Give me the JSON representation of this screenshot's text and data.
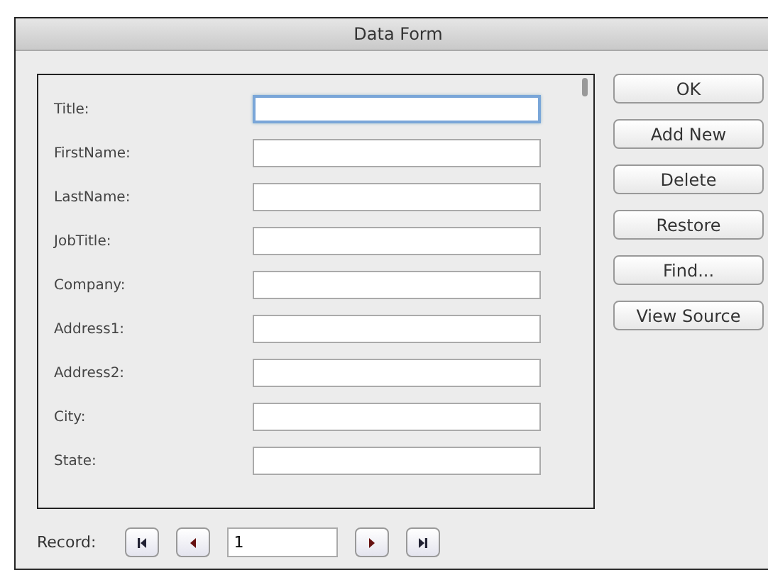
{
  "window": {
    "title": "Data Form"
  },
  "fields": [
    {
      "label": "Title:",
      "focused": true
    },
    {
      "label": "FirstName:",
      "focused": false
    },
    {
      "label": "LastName:",
      "focused": false
    },
    {
      "label": "JobTitle:",
      "focused": false
    },
    {
      "label": "Company:",
      "focused": false
    },
    {
      "label": "Address1:",
      "focused": false
    },
    {
      "label": "Address2:",
      "focused": false
    },
    {
      "label": "City:",
      "focused": false
    },
    {
      "label": "State:",
      "focused": false
    }
  ],
  "buttons": [
    "OK",
    "Add New",
    "Delete",
    "Restore",
    "Find...",
    "View Source"
  ],
  "record": {
    "label": "Record:",
    "value": "1"
  }
}
